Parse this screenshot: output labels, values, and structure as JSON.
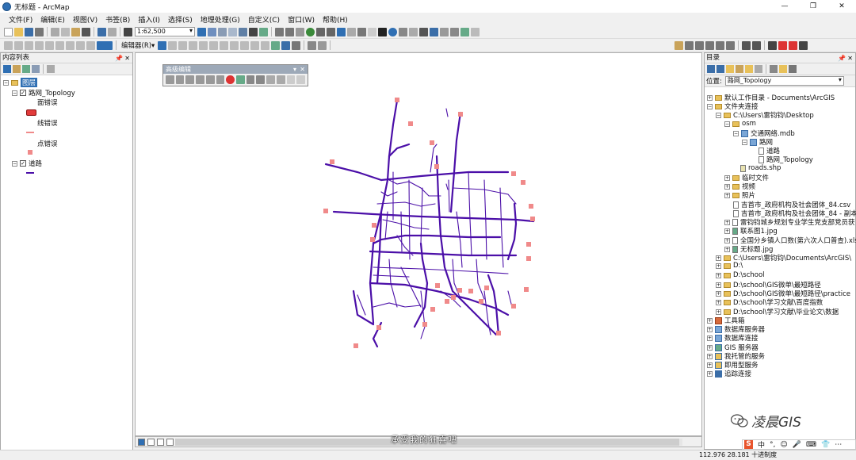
{
  "window": {
    "title": "无标题 - ArcMap",
    "controls": [
      "—",
      "❐",
      "✕"
    ]
  },
  "menu": [
    "文件(F)",
    "编辑(E)",
    "视图(V)",
    "书签(B)",
    "插入(I)",
    "选择(S)",
    "地理处理(G)",
    "自定义(C)",
    "窗口(W)",
    "帮助(H)"
  ],
  "toolbar": {
    "scale": "1:62,500",
    "editor_label": "编辑器(R)▾"
  },
  "toc": {
    "title": "内容列表",
    "layers_label": "图层",
    "topology_layer": "路网_Topology",
    "legend": {
      "area_error": "面错误",
      "line_error": "线错误",
      "point_error": "点错误"
    },
    "road_layer": "道路"
  },
  "advanced_editing": {
    "title": "高级编辑"
  },
  "catalog": {
    "title": "目录",
    "location_label": "位置:",
    "location_value": "路网_Topology",
    "items": [
      "默认工作目录 - Documents\\ArcGIS",
      "文件夹连接",
      "C:\\Users\\雷钧钧\\Desktop",
      "osm",
      "交通网络.mdb",
      "路网",
      "道路",
      "路网_Topology",
      "roads.shp",
      "临时文件",
      "视频",
      "照片",
      "吉首市_政府机构及社会团体_84.csv",
      "吉首市_政府机构及社会团体_84 - 副本",
      "雷钧钧城乡规划专业学生党支部党员获",
      "联系图1.jpg",
      "全国分乡镇人口数(第六次人口普查).xls",
      "无标题.jpg",
      "C:\\Users\\雷钧钧\\Documents\\ArcGIS\\",
      "D:\\",
      "D:\\school",
      "D:\\school\\GIS微单\\最短路径",
      "D:\\school\\GIS微单\\最短路径\\practice",
      "D:\\school\\学习文献\\百度指数",
      "D:\\school\\学习文献\\毕业论文\\数据",
      "工具箱",
      "数据库服务器",
      "数据库连接",
      "GIS 服务器",
      "我托管的服务",
      "即用型服务",
      "追踪连接"
    ]
  },
  "status": {
    "coords": "112.976  28.181 十进制度"
  },
  "subtitle": "承受我的狂喜吧",
  "watermark": "凌晨GIS",
  "ime": {
    "logo": "S",
    "lang": "中",
    "items": [
      "°,",
      "☺",
      "🎤",
      "⌨",
      "👕",
      "⋯"
    ]
  },
  "colors": {
    "road": "#4b0fa8",
    "error_point": "#f08a8a",
    "selection": "#2f6fb3",
    "line_error": "#f08a8a",
    "area_error": "#e23b3b"
  }
}
